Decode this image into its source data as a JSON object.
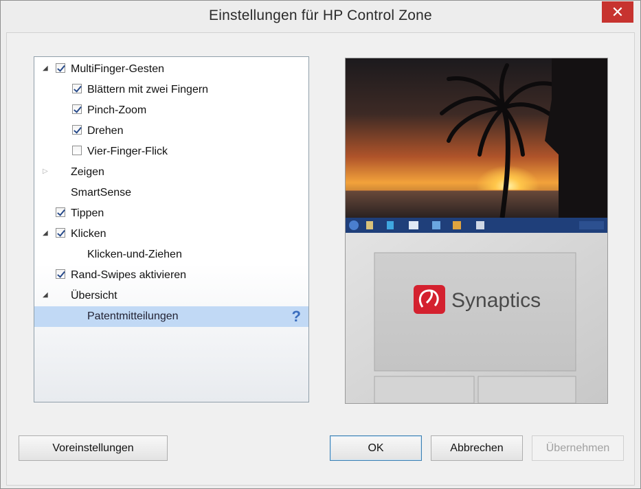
{
  "window": {
    "title": "Einstellungen für HP Control Zone",
    "close_glyph": "✕"
  },
  "tree": {
    "items": [
      {
        "label": "MultiFinger-Gesten",
        "checked": true
      },
      {
        "label": "Blättern mit zwei Fingern",
        "checked": true
      },
      {
        "label": "Pinch-Zoom",
        "checked": true
      },
      {
        "label": "Drehen",
        "checked": true
      },
      {
        "label": "Vier-Finger-Flick",
        "checked": false
      },
      {
        "label": "Zeigen"
      },
      {
        "label": "SmartSense"
      },
      {
        "label": "Tippen",
        "checked": true
      },
      {
        "label": "Klicken",
        "checked": true
      },
      {
        "label": "Klicken-und-Ziehen"
      },
      {
        "label": "Rand-Swipes aktivieren",
        "checked": true
      },
      {
        "label": "Übersicht"
      },
      {
        "label": "Patentmitteilungen",
        "selected": true
      }
    ],
    "help_glyph": "?"
  },
  "preview": {
    "brand": "Synaptics"
  },
  "buttons": {
    "defaults": "Voreinstellungen",
    "ok": "OK",
    "cancel": "Abbrechen",
    "apply": "Übernehmen"
  }
}
